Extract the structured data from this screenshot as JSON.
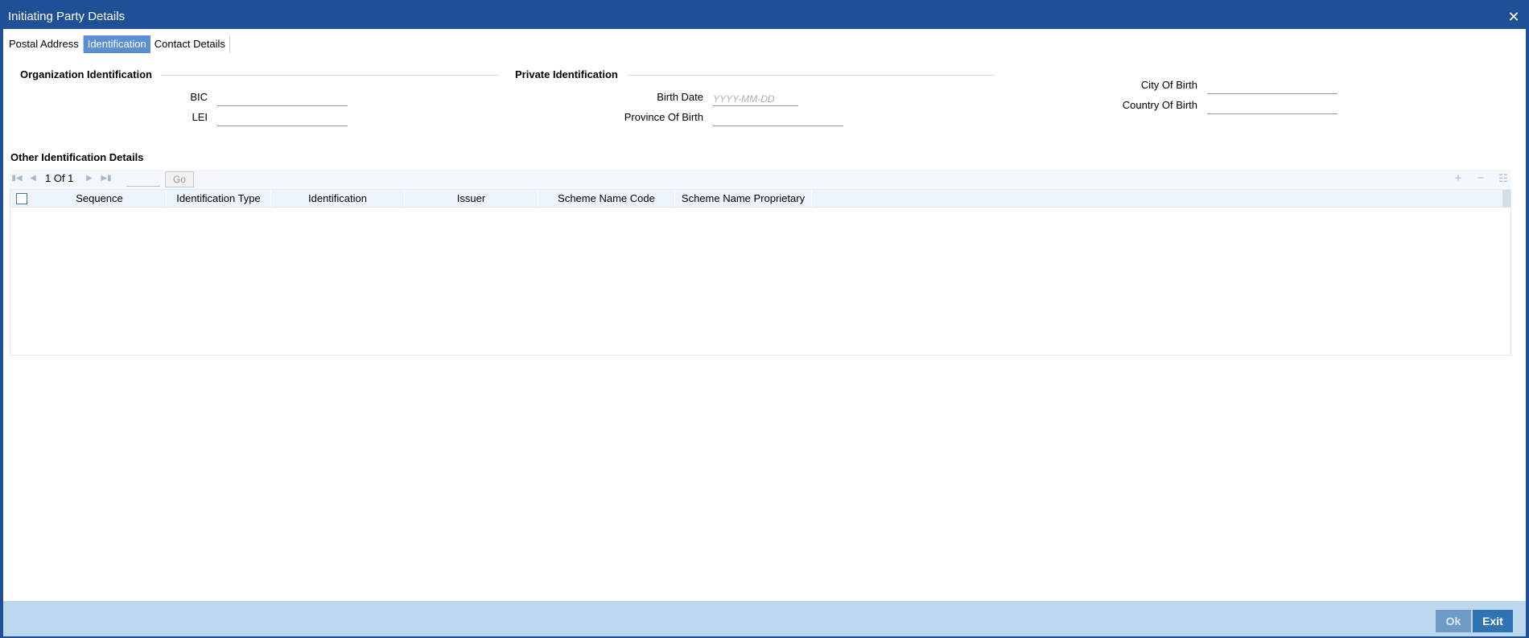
{
  "window": {
    "title": "Initiating Party Details",
    "close_symbol": "✕"
  },
  "tabs": [
    {
      "label": "Postal Address",
      "active": false
    },
    {
      "label": "Identification",
      "active": true
    },
    {
      "label": "Contact Details",
      "active": false
    }
  ],
  "org_ident": {
    "title": "Organization Identification",
    "bic_label": "BIC",
    "bic_value": "",
    "lei_label": "LEI",
    "lei_value": ""
  },
  "private_ident": {
    "title": "Private Identification",
    "birth_date_label": "Birth Date",
    "birth_date_placeholder": "YYYY-MM-DD",
    "province_label": "Province Of Birth",
    "province_value": "",
    "city_label": "City Of Birth",
    "city_value": "",
    "country_label": "Country Of Birth",
    "country_value": ""
  },
  "other_ident": {
    "title": "Other Identification Details",
    "pager_text": "1 Of 1",
    "go_label": "Go",
    "columns": [
      "Sequence",
      "Identification Type",
      "Identification",
      "Issuer",
      "Scheme Name Code",
      "Scheme Name Proprietary"
    ],
    "rows": []
  },
  "icons": {
    "first": "first-page-icon",
    "prev": "prev-page-icon",
    "next": "next-page-icon",
    "last": "last-page-icon",
    "add": "add-row-icon",
    "delete": "delete-row-icon",
    "view": "single-view-icon"
  },
  "footer": {
    "ok_label": "Ok",
    "exit_label": "Exit"
  },
  "colors": {
    "titlebar": "#1f4f95",
    "active_tab": "#5b8fd4",
    "footer": "#bcd8ee",
    "exit_button": "#2f73b3"
  }
}
